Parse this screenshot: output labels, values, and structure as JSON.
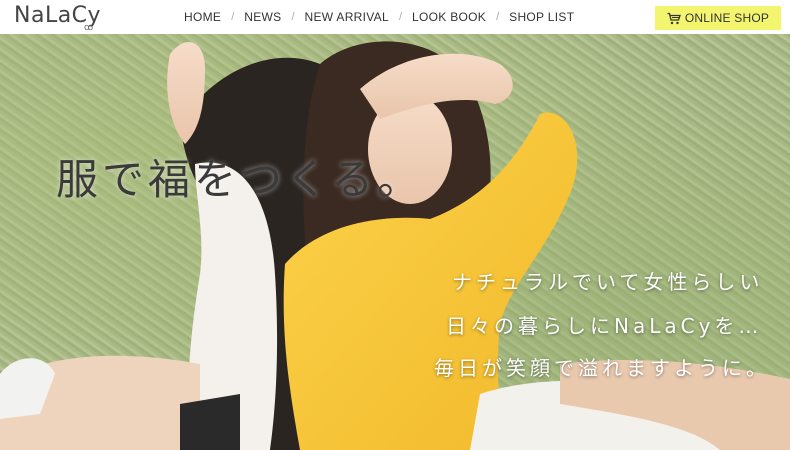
{
  "header": {
    "logo": "NaLaCy",
    "nav": [
      "HOME",
      "NEWS",
      "NEW ARRIVAL",
      "LOOK BOOK",
      "SHOP LIST"
    ],
    "online_shop_label": "ONLINE SHOP",
    "online_shop_icon": "cart-icon",
    "accent_color": "#f4f56f"
  },
  "hero": {
    "tagline": "服で福をつくる。",
    "message_lines": [
      "ナチュラルでいて女性らしい",
      "日々の暮らしにNaLaCyを…",
      "毎日が笑顔で溢れますように。"
    ]
  }
}
